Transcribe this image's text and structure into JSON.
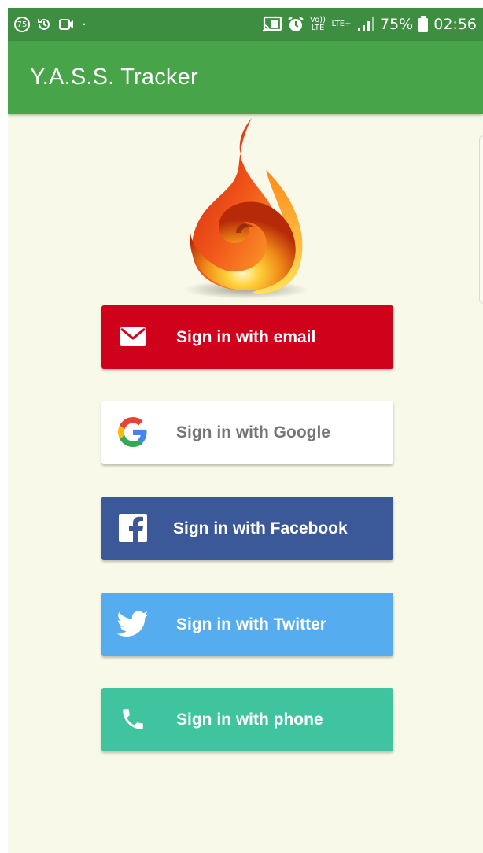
{
  "status_bar": {
    "notification_count": "75",
    "battery": "75%",
    "time": "02:56",
    "volte_label": "Vo)) LTE",
    "lte_label": "LTE+",
    "icons_left": [
      "notification-count-icon",
      "history-icon",
      "video-icon",
      "dot-icon"
    ],
    "icons_right": [
      "cast-icon",
      "alarm-icon",
      "volte-icon",
      "lte-icon",
      "signal-icon",
      "battery-icon"
    ]
  },
  "app_bar": {
    "title": "Y.A.S.S. Tracker",
    "color": "#47a448"
  },
  "logo": {
    "icon": "flame-logo-icon"
  },
  "sign_in": {
    "email": {
      "label": "Sign in with email",
      "icon": "envelope-icon",
      "color": "#d0021b"
    },
    "google": {
      "label": "Sign in with Google",
      "icon": "google-icon",
      "color": "#ffffff"
    },
    "facebook": {
      "label": "Sign in with Facebook",
      "icon": "facebook-icon",
      "color": "#3b5998"
    },
    "twitter": {
      "label": "Sign in with Twitter",
      "icon": "twitter-bird-icon",
      "color": "#55acee"
    },
    "phone": {
      "label": "Sign in with phone",
      "icon": "phone-icon",
      "color": "#40c4a0"
    }
  }
}
